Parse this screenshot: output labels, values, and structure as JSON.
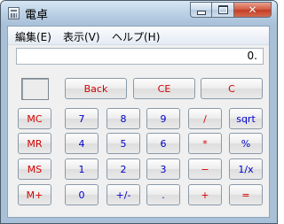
{
  "window": {
    "title": "電卓"
  },
  "menu": [
    "編集(E)",
    "表示(V)",
    "ヘルプ(H)"
  ],
  "display": {
    "value": "0."
  },
  "buttons": {
    "back": "Back",
    "ce": "CE",
    "c": "C",
    "mc": "MC",
    "mr": "MR",
    "ms": "MS",
    "mplus": "M+",
    "n7": "7",
    "n8": "8",
    "n9": "9",
    "div": "/",
    "sqrt": "sqrt",
    "n4": "4",
    "n5": "5",
    "n6": "6",
    "mul": "*",
    "pct": "%",
    "n1": "1",
    "n2": "2",
    "n3": "3",
    "sub": "−",
    "recip": "1/x",
    "n0": "0",
    "sign": "+/-",
    "dot": ".",
    "add": "+",
    "eq": "="
  },
  "colors": {
    "operator": "#d40000",
    "digit": "#0000c8"
  },
  "icons": {
    "app": "calculator-icon",
    "minimize": "minimize-icon",
    "maximize": "maximize-icon",
    "close": "close-icon"
  }
}
